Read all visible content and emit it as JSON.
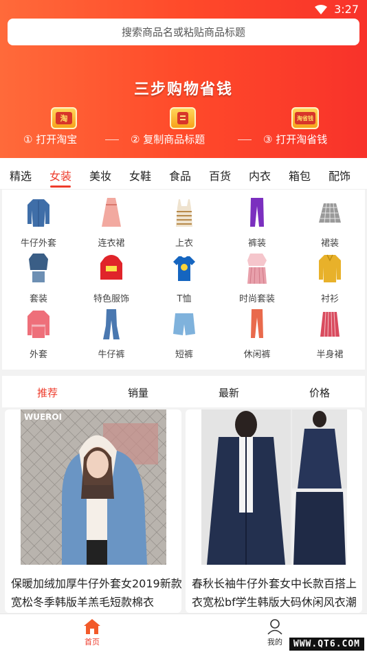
{
  "status_bar": {
    "time": "3:27"
  },
  "search": {
    "placeholder": "搜索商品名或粘贴商品标题"
  },
  "banner": {
    "slogan": "三步购物省钱",
    "steps": [
      {
        "num": "①",
        "label": "打开淘宝",
        "icon": "taobao-icon",
        "icon_text": "淘"
      },
      {
        "num": "②",
        "label": "复制商品标题",
        "icon": "copy-icon",
        "icon_text": ""
      },
      {
        "num": "③",
        "label": "打开淘省钱",
        "icon": "save-money-icon",
        "icon_text": "淘省钱"
      }
    ]
  },
  "category_tabs": {
    "active": "女装",
    "items": [
      "精选",
      "女装",
      "美妆",
      "女鞋",
      "食品",
      "百货",
      "内衣",
      "箱包",
      "配饰"
    ]
  },
  "subcategories": [
    {
      "label": "牛仔外套",
      "icon": "denim-jacket-icon",
      "color": "#3f6ea8"
    },
    {
      "label": "连衣裙",
      "icon": "dress-icon",
      "color": "#f2a9a0"
    },
    {
      "label": "上衣",
      "icon": "top-icon",
      "color": "#c9a56a"
    },
    {
      "label": "裤装",
      "icon": "pants-icon",
      "color": "#7b2fbf"
    },
    {
      "label": "裙装",
      "icon": "skirt-icon",
      "color": "#8a8a8a"
    },
    {
      "label": "套装",
      "icon": "suit-icon",
      "color": "#3a5e86"
    },
    {
      "label": "特色服饰",
      "icon": "hoodie-icon",
      "color": "#e0242a"
    },
    {
      "label": "T恤",
      "icon": "tshirt-icon",
      "color": "#1565c0"
    },
    {
      "label": "时尚套装",
      "icon": "fashion-set-icon",
      "color": "#e8a0ab"
    },
    {
      "label": "衬衫",
      "icon": "shirt-icon",
      "color": "#e8b12a"
    },
    {
      "label": "外套",
      "icon": "coat-icon",
      "color": "#ee6f7a"
    },
    {
      "label": "牛仔裤",
      "icon": "jeans-icon",
      "color": "#4a78b0"
    },
    {
      "label": "短裤",
      "icon": "shorts-icon",
      "color": "#7fb2dc"
    },
    {
      "label": "休闲裤",
      "icon": "casual-pants-icon",
      "color": "#e96a4c"
    },
    {
      "label": "半身裙",
      "icon": "half-skirt-icon",
      "color": "#d94b5e"
    }
  ],
  "sort_bar": {
    "active": "推荐",
    "items": [
      "推荐",
      "销量",
      "最新",
      "价格"
    ]
  },
  "products": [
    {
      "title": "保暖加绒加厚牛仔外套女2019新款宽松冬季韩版羊羔毛短款棉衣",
      "brand_mark": "WUEROI"
    },
    {
      "title": "春秋长袖牛仔外套女中长款百搭上衣宽松bf学生韩版大码休闲风衣潮"
    }
  ],
  "tabbar": {
    "home_label": "首页",
    "mine_label": "我的"
  },
  "watermark": "WWW.QT6.COM",
  "colors": {
    "accent": "#ee3b2b",
    "banner_start": "#ff6a3a",
    "banner_end": "#f8322a"
  }
}
